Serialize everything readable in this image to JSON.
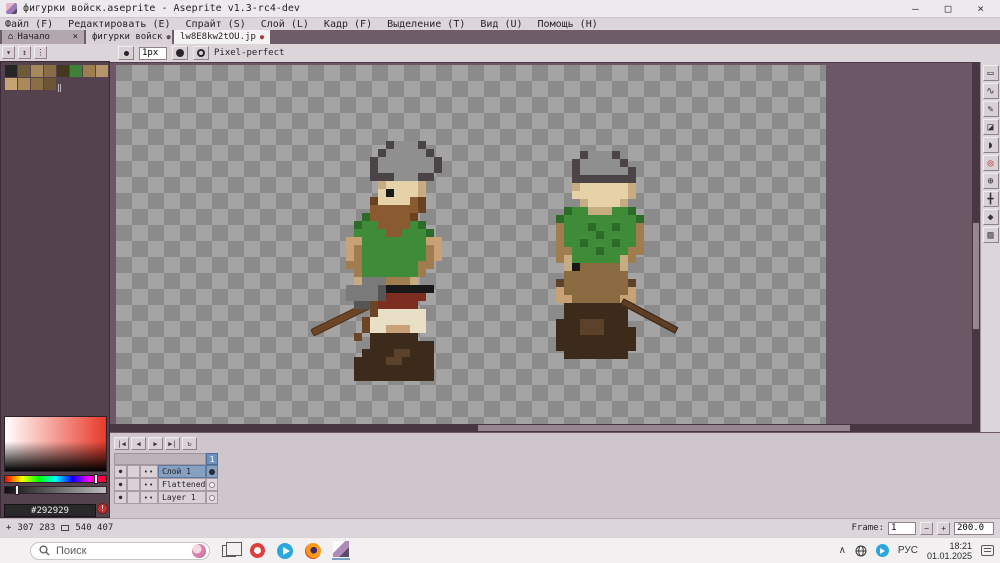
{
  "window": {
    "title": "фигурки войск.aseprite - Aseprite v1.3-rc4-dev",
    "minimize": "–",
    "maximize": "□",
    "close": "×"
  },
  "menu": {
    "items": [
      "Файл (F)",
      "Редактировать (E)",
      "Спрайт (S)",
      "Слой (L)",
      "Кадр (F)",
      "Выделение (T)",
      "Вид (U)",
      "Помощь (H)"
    ]
  },
  "tabs": {
    "home": {
      "icon": "⌂",
      "label": "Начало",
      "close": "×"
    },
    "active": {
      "label": "фигурки войск",
      "modified": "●"
    },
    "jpeg": {
      "label": "lw8E8kw2tOU.jp",
      "modified": "●"
    }
  },
  "context_toolbar": {
    "brush_size": "1px",
    "pixel_perfect": "Pixel-perfect"
  },
  "palette": {
    "rows": [
      [
        "#262626",
        "#6f5a3c",
        "#a68a5c",
        "#8a6d46",
        "#46381f",
        "#3d8236",
        "#9c7e50",
        "#b3966a"
      ],
      [
        "#c6a372",
        "#aa8a5a",
        "#8c6e44",
        "#6d5435"
      ]
    ],
    "separator": "‖"
  },
  "color_selector": {
    "foreground": "#292929",
    "background": "#225117",
    "warning": "!"
  },
  "tools": [
    {
      "name": "rectangular-marquee",
      "glyph": "▭"
    },
    {
      "name": "lasso",
      "glyph": "∿"
    },
    {
      "name": "pencil",
      "glyph": "✎"
    },
    {
      "name": "eraser",
      "glyph": "◪"
    },
    {
      "name": "eyedropper",
      "glyph": "◗"
    },
    {
      "name": "zoom",
      "glyph": "◎"
    },
    {
      "name": "hand",
      "glyph": "⊕"
    },
    {
      "name": "move",
      "glyph": "╋"
    },
    {
      "name": "paint-bucket",
      "glyph": "◆"
    },
    {
      "name": "gradient",
      "glyph": "▨"
    }
  ],
  "editor": {
    "checker_light": "#a4a4a4",
    "checker_dark": "#8b8b8b",
    "outside": "#6b5765"
  },
  "sprites": {
    "cell": 8,
    "colors": {
      "h": "#4a4446",
      "H": "#8f8f8f",
      "L": "#b8b8b8",
      "S": "#e6d2a8",
      "s": "#c6ac80",
      "K": "#181818",
      "B": "#8a5a30",
      "b": "#6b4220",
      "G": "#3f8c38",
      "g": "#2d6b2a",
      "T": "#c8a276",
      "t": "#a17c4e",
      "C": "#e9dec6",
      "R": "#7c2e20",
      "A": "#7a7a7a",
      "a": "#565656",
      "W": "#6b4526",
      "D": "#3c2b1a",
      "d": "#5c422a",
      "P": "#8a6a40"
    },
    "figures": [
      {
        "name": "warrior-with-axe-front",
        "rows": [
          "......hHHHh",
          ".....hHHHHHh",
          "....hHHHHHHHh",
          "....hHHHHHHHh",
          "....hhhHHHhh",
          ".....sSSSSs",
          ".....SKSSSs",
          "....bSSSSBb",
          "....BBBBBBb",
          "...gBBBBBb",
          "..gGGBBBBGg",
          "..GGGGBBGGGg",
          ".TTGGGGGGGGTT",
          ".TtGGGGGGGGtT",
          ".TtGGGGGGGGtT",
          ".ttGGGGGGGtt",
          "..tGGGGGGGt",
          "..sAAAttts",
          ".AAAAaKKKKKK",
          ".AAAAaRRRRR",
          "..aaWRRRRR",
          "....WCCCCCC",
          "...WCCCCCCC",
          "...WCCTTTCC",
          "..W.DDDDDD",
          "....DDDDDDDD",
          "...DDDDddDDD",
          "..DDDDddDDDD",
          "..DDDDDDDDDD",
          "..DDDDDDDDDD"
        ]
      },
      {
        "name": "warrior-back-with-sword",
        "rows": [
          "....hHHHh",
          "...hHHHHHh",
          "...hHHHHHHh",
          "...hhhhhhhh",
          "...sSSSSSSs",
          "...SSSSSSSs",
          "....sSSSSs",
          "..gGGsssGGg",
          ".gGGGGGGGGGg",
          ".tGGGgGGgGGt",
          ".tGGGGgGGGGt",
          ".tGGgGGGgGGt",
          ".ttGGGgGGGtt",
          ".tsGGGGGGst",
          "..sKPPPPPs",
          "..PPPPPPPP",
          ".dPPPPPPPPd",
          ".TPPPPPPPPT",
          ".TTPPPPPPTT",
          "..DDDDDDDD",
          "..DDDDDDDD",
          ".DDDdddDDD",
          ".DDDdddDDDD",
          ".DDDDDDDDDD",
          ".DDDDDDDDDD",
          "..DDDDDDDD"
        ]
      }
    ]
  },
  "timeline": {
    "playback": [
      "|◀",
      "◀",
      "▶",
      "▶|",
      "↻"
    ],
    "frame_header": "1",
    "icons": {
      "continuous": "••"
    },
    "layers": [
      {
        "name": "Слой 1"
      },
      {
        "name": "Flattened"
      },
      {
        "name": "Layer 1"
      }
    ]
  },
  "statusbar": {
    "cursor_glyph": "+",
    "position": "307 283",
    "size": "540 407",
    "frame_label": "Frame:",
    "frame_value": "1",
    "dec": "−",
    "inc": "+",
    "zoom": "200.0"
  },
  "taskbar": {
    "search_placeholder": "Поиск",
    "language": "РУС",
    "time": "18:21",
    "date": "01.01.2025"
  }
}
